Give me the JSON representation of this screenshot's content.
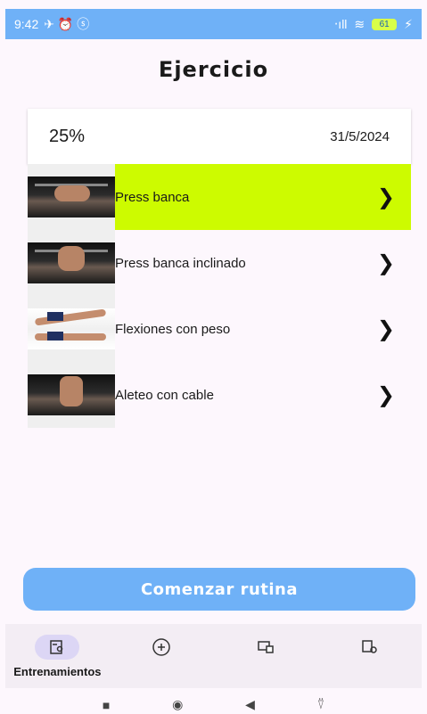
{
  "status_bar": {
    "time": "9:42",
    "left_icons": "✈ ⏰ ⓢ",
    "signal": "‧ıll",
    "wifi": "≋",
    "battery": "61",
    "charging": "⚡"
  },
  "header": {
    "title": "Ejercicio"
  },
  "summary": {
    "progress": "25%",
    "date": "31/5/2024"
  },
  "exercises": [
    {
      "name": "Press banca",
      "selected": true
    },
    {
      "name": "Press banca inclinado",
      "selected": false
    },
    {
      "name": "Flexiones con peso",
      "selected": false
    },
    {
      "name": "Aleteo con cable",
      "selected": false
    }
  ],
  "chevron": "❯",
  "action": {
    "start_label": "Comenzar rutina"
  },
  "bottom_nav": [
    {
      "icon": "list-person-icon",
      "label": "Entrenamientos",
      "active": true
    },
    {
      "icon": "add-circle-icon",
      "label": "",
      "active": false
    },
    {
      "icon": "devices-icon",
      "label": "",
      "active": false
    },
    {
      "icon": "book-settings-icon",
      "label": "",
      "active": false
    }
  ],
  "system_nav": {
    "square": "■",
    "home": "◉",
    "back": "◀",
    "person": "⍢"
  },
  "colors": {
    "accent": "#6fb1f7",
    "highlight": "#cdfb00",
    "nav_bg": "#f3edf4"
  }
}
